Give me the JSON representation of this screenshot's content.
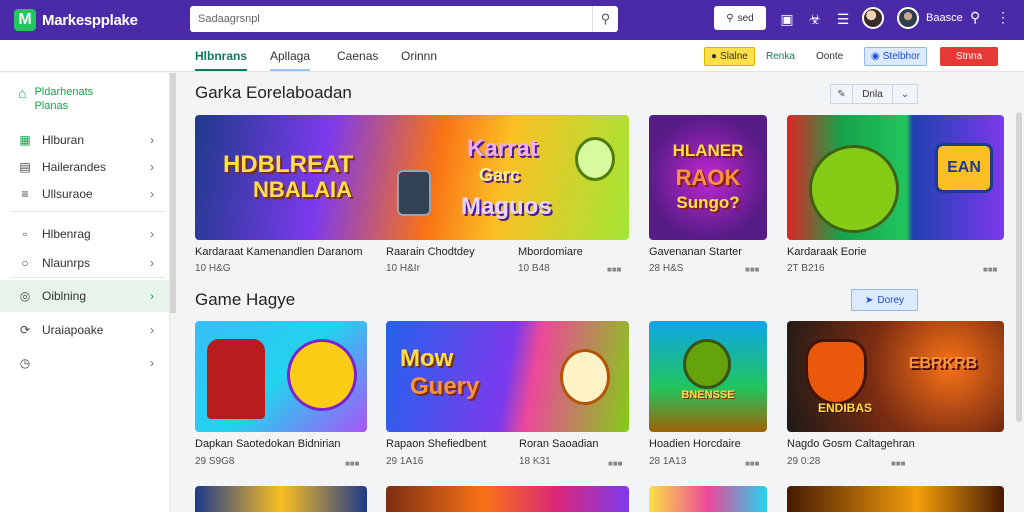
{
  "header": {
    "logo_mark": "M",
    "logo_text": "Markespplake",
    "search_placeholder": "Sadaagrsnpl",
    "search_button": "sed",
    "user_name": "Baasce"
  },
  "subnav": {
    "tabs": [
      "Hlbnrans",
      "Apllaga",
      "Caenas",
      "Orinnn"
    ],
    "active_index": 0,
    "right_items": [
      "Slalne",
      "Renka",
      "Oonte",
      "Stelbhor",
      "Stnna"
    ]
  },
  "sidebar": {
    "header": [
      "Pldarhenats",
      "Planas"
    ],
    "items": [
      {
        "label": "Hlburan",
        "icon": "calendar-icon"
      },
      {
        "label": "Hailerandes",
        "icon": "document-icon"
      },
      {
        "label": "Ullsuraoe",
        "icon": "list-icon"
      },
      {
        "label": "Hlbenrag",
        "icon": "bookmark-icon"
      },
      {
        "label": "Nlaunrps",
        "icon": "circle-icon"
      },
      {
        "label": "Oiblning",
        "icon": "target-icon"
      },
      {
        "label": "Uraiapoake",
        "icon": "refresh-icon"
      },
      {
        "label": "",
        "icon": "clock-icon"
      }
    ],
    "active_index": 5
  },
  "section1": {
    "title": "Garka Eorelaboadan",
    "controls": [
      "Dnla"
    ],
    "cards": [
      {
        "title": "Kardaraat Kamenandlen Daranom",
        "meta": "10 H&G",
        "art": [
          "HDBLREAT",
          "NBALAIA"
        ]
      },
      {
        "title": "Raarain Chodtdey",
        "meta": "10 H&Ir",
        "art": [
          "Karrat",
          "Garc"
        ]
      },
      {
        "title": "Mbordomiare",
        "meta": "10 B48",
        "art": [
          "Maguos"
        ]
      },
      {
        "title": "Gavenanan Starter",
        "meta": "28 H&S",
        "art": [
          "HLANER",
          "RAOK",
          "Sungo?"
        ]
      },
      {
        "title": "Kardaraak Eorie",
        "meta": "2T B216",
        "art": [
          "EAN"
        ]
      }
    ]
  },
  "section2": {
    "title": "Game Hagye",
    "view_button": "Dorey",
    "cards": [
      {
        "title": "Dapkan Saotedokan Bidnirian",
        "meta": "29 S9G8",
        "art": []
      },
      {
        "title": "Rapaon Shefiedbent",
        "meta": "29 1A16",
        "art": [
          "Mow",
          "Guery"
        ]
      },
      {
        "title": "Roran Saoadian",
        "meta": "18 K31",
        "art": []
      },
      {
        "title": "Hoadien Horcdaire",
        "meta": "28 1A13",
        "art": [
          "BNENSSE"
        ]
      },
      {
        "title": "Nagdo Gosm Caltagehran",
        "meta": "29 0:28",
        "art": [
          "EBRKRB",
          "ENDIBAS"
        ]
      }
    ]
  },
  "colors": {
    "header_bg": "#4b2aa8",
    "accent_green": "#16a34a",
    "accent_red": "#e53935",
    "accent_blue": "#1d4ed8"
  }
}
